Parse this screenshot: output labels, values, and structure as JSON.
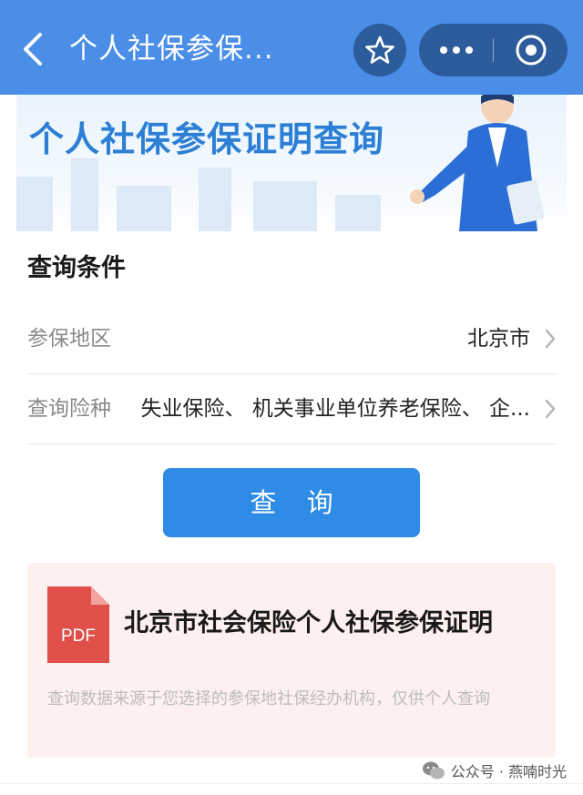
{
  "header": {
    "title": "个人社保参保...",
    "back_icon": "chevron-left-icon",
    "favorite_icon": "star-icon",
    "more_icon": "more-dots-icon",
    "close_icon": "target-circle-icon",
    "background": "#4b8ee8"
  },
  "banner": {
    "title": "个人社保参保证明查询"
  },
  "query": {
    "section_title": "查询条件",
    "fields": [
      {
        "label": "参保地区",
        "value": "北京市"
      },
      {
        "label": "查询险种",
        "value": "失业保险、 机关事业单位养老保险、 企..."
      }
    ],
    "submit_label": "查 询"
  },
  "result": {
    "icon_label": "PDF",
    "title": "北京市社会保险个人社保参保证明",
    "note": "查询数据来源于您选择的参保地社保经办机构，仅供个人查询"
  },
  "watermark": {
    "text": "公众号 · 燕喃时光"
  },
  "colors": {
    "primary": "#2f8ce6",
    "banner_title": "#2c7fd4",
    "pdf_red": "#e04f4a",
    "card_bg": "#fdf0ef"
  }
}
